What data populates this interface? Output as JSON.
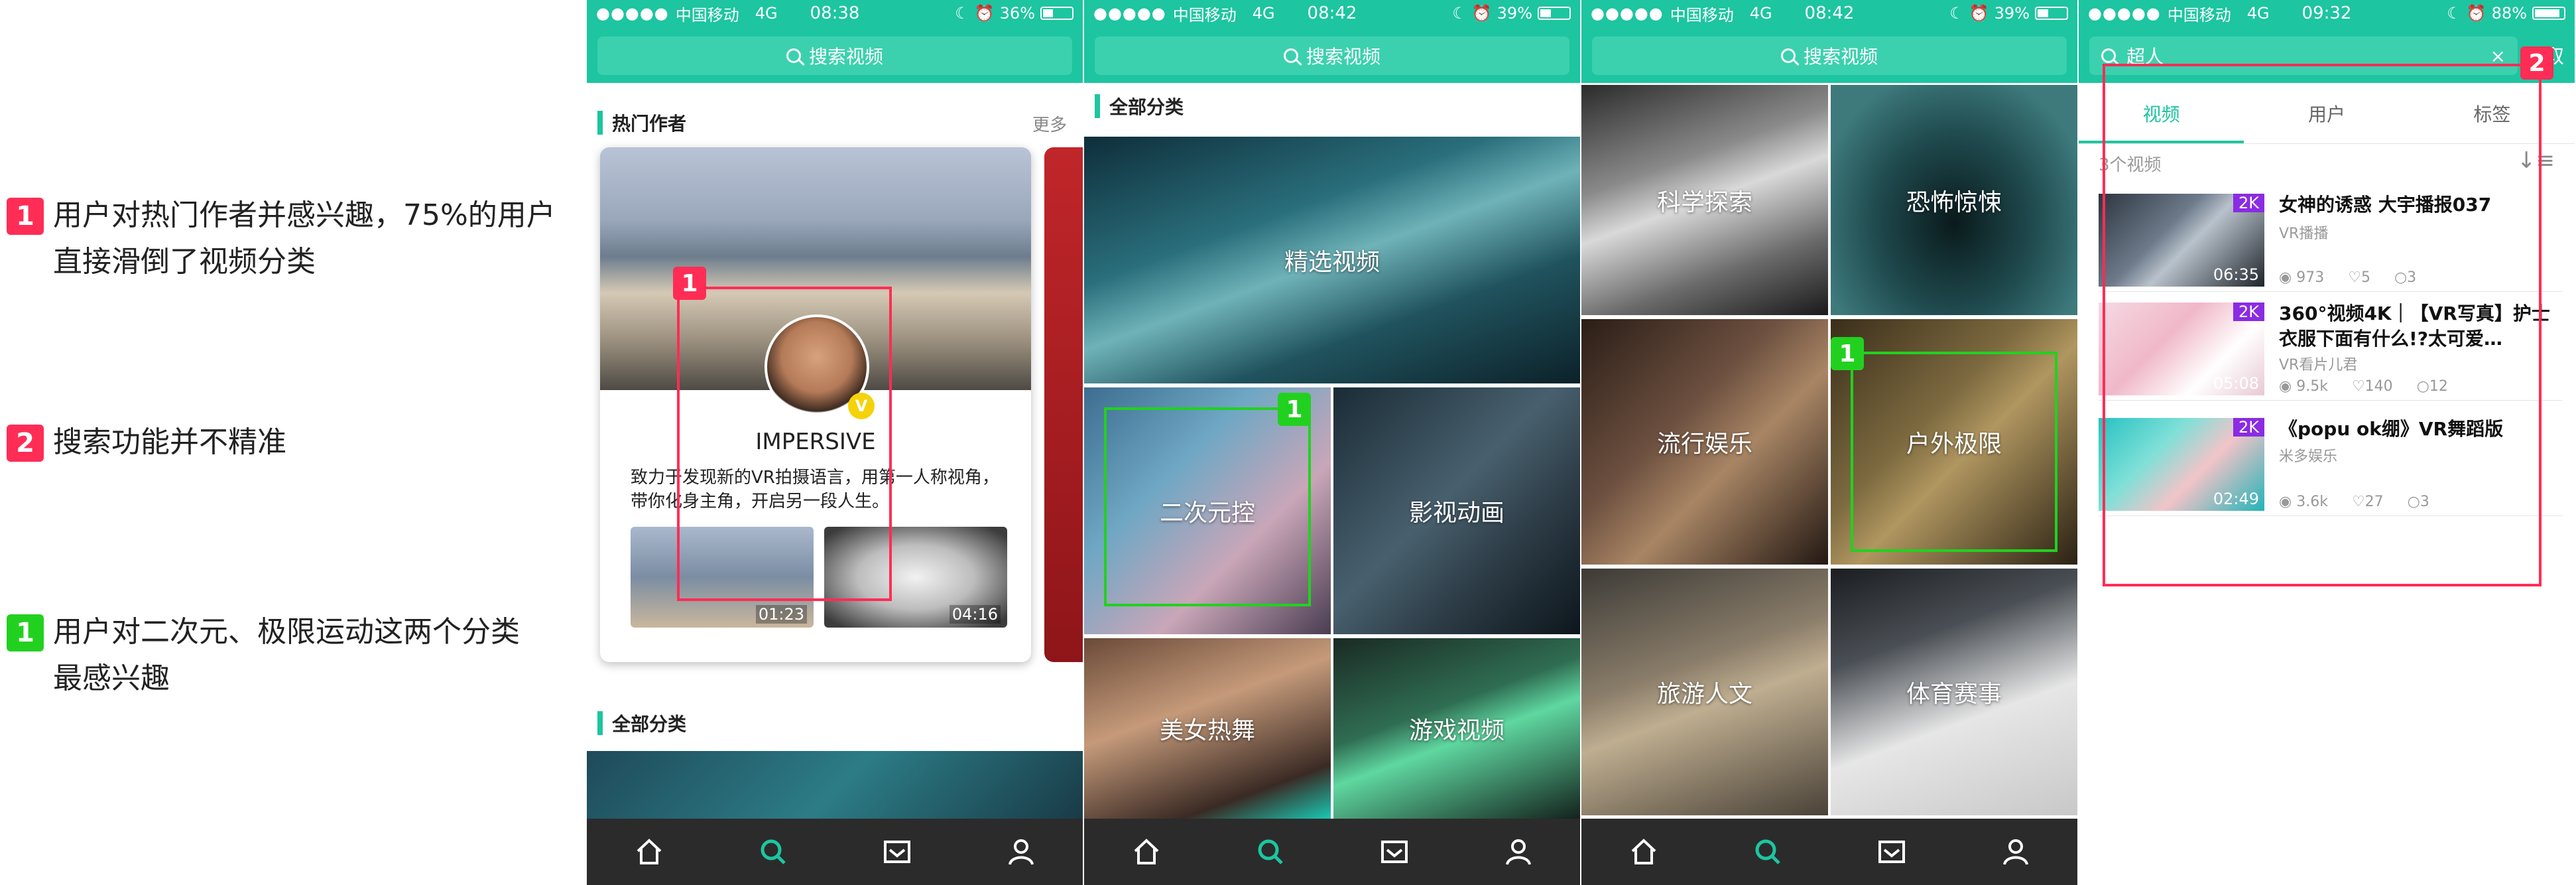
{
  "notes": [
    {
      "num": "1",
      "text": "用户对热门作者并感兴趣，75%的用户直接滑倒了视频分类"
    },
    {
      "num": "2",
      "text": "搜索功能并不精准"
    },
    {
      "num": "1",
      "text": "用户对二次元、极限运动这两个分类最感兴趣"
    }
  ],
  "phones": [
    {
      "signal": "●●●●●",
      "carrier": "中国移动",
      "net": "4G",
      "time": "08:38",
      "battery": "36%",
      "battery_fill": 0.36
    },
    {
      "signal": "●●●●●",
      "carrier": "中国移动",
      "net": "4G",
      "time": "08:42",
      "battery": "39%",
      "battery_fill": 0.39
    },
    {
      "signal": "●●●●●",
      "carrier": "中国移动",
      "net": "4G",
      "time": "08:42",
      "battery": "39%",
      "battery_fill": 0.39
    },
    {
      "signal": "●●●●●",
      "carrier": "中国移动",
      "net": "4G",
      "time": "09:32",
      "battery": "88%",
      "battery_fill": 0.88
    }
  ],
  "search_placeholder": "搜索视频",
  "p1": {
    "hot_title": "热门作者",
    "more": "更多",
    "author": "IMPERSIVE",
    "v": "V",
    "desc": "致力于发现新的VR拍摄语言，用第一人称视角，带你化身主角，开启另一段人生。",
    "thumbs": [
      "01:23",
      "04:16"
    ],
    "all_title": "全部分类",
    "box_num": "1"
  },
  "p2": {
    "all_title": "全部分类",
    "featured": "精选视频",
    "tiles": [
      "二次元控",
      "影视动画",
      "美女热舞",
      "游戏视频"
    ],
    "box_num": "1"
  },
  "p3": {
    "tiles": [
      "科学探索",
      "恐怖惊悚",
      "流行娱乐",
      "户外极限",
      "旅游人文",
      "体育赛事"
    ],
    "box_num": "1"
  },
  "p4": {
    "query": "超人",
    "clear": "×",
    "cancel": "取",
    "tabs": [
      "视频",
      "用户",
      "标签"
    ],
    "count": "3个视频",
    "sort": "↓≡",
    "box_num": "2",
    "results": [
      {
        "badge": "2K",
        "dur": "06:35",
        "title": "女神的诱惑 大宇播报037",
        "sub": "VR播播",
        "views": "973",
        "likes": "5",
        "comments": "3"
      },
      {
        "badge": "2K",
        "dur": "05:08",
        "title": "360°视频4K｜【VR写真】护士衣服下面有什么!?太可爱…",
        "sub": "VR看片儿君",
        "views": "9.5k",
        "likes": "140",
        "comments": "12"
      },
      {
        "badge": "2K",
        "dur": "02:49",
        "title": "《popu ok绷》VR舞蹈版",
        "sub": "米多娱乐",
        "views": "3.6k",
        "likes": "27",
        "comments": "3"
      }
    ]
  },
  "colors": {
    "accent": "#1dc5a0",
    "red_mark": "#ff2d55",
    "green_mark": "#22d11f",
    "tabbar": "#2b2b2b",
    "badge_2k": "#8b2be2"
  }
}
